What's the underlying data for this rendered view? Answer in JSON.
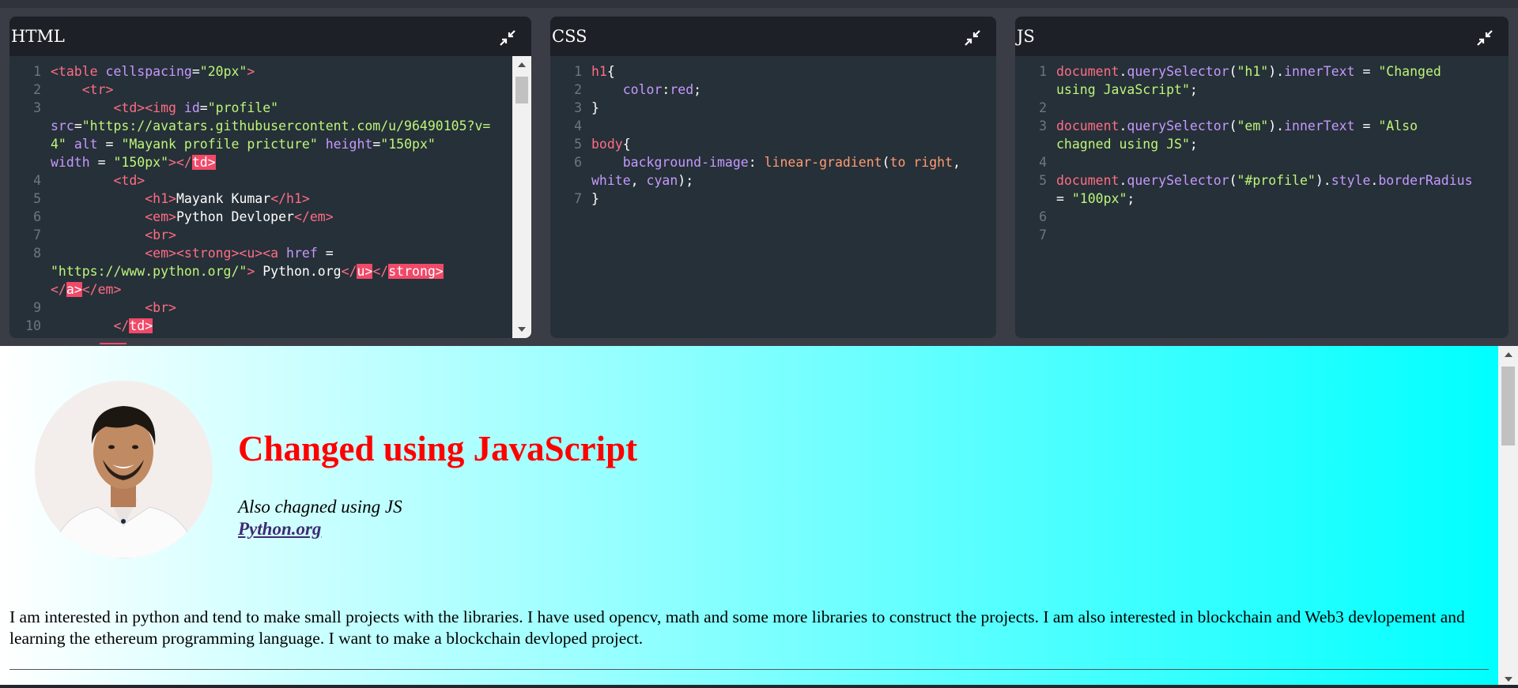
{
  "panels": {
    "html": {
      "title": "HTML",
      "lines": [
        {
          "n": "1",
          "segs": [
            {
              "c": "tg",
              "t": "<table "
            },
            {
              "c": "at",
              "t": "cellspacing"
            },
            {
              "c": "",
              "t": "="
            },
            {
              "c": "st",
              "t": "\"20px\""
            },
            {
              "c": "tg",
              "t": ">"
            }
          ]
        },
        {
          "n": "2",
          "segs": [
            {
              "c": "",
              "t": "    "
            },
            {
              "c": "tg",
              "t": "<tr>"
            }
          ]
        },
        {
          "n": "3",
          "segs": [
            {
              "c": "",
              "t": "        "
            },
            {
              "c": "tg",
              "t": "<td><img "
            },
            {
              "c": "at",
              "t": "id"
            },
            {
              "c": "",
              "t": "="
            },
            {
              "c": "st",
              "t": "\"profile\""
            },
            {
              "c": "",
              "t": "\n"
            },
            {
              "c": "at",
              "t": "src"
            },
            {
              "c": "",
              "t": "="
            },
            {
              "c": "st",
              "t": "\"https://avatars.githubusercontent.com/u/96490105?v=4\""
            },
            {
              "c": "",
              "t": " "
            },
            {
              "c": "at",
              "t": "alt"
            },
            {
              "c": "",
              "t": " = "
            },
            {
              "c": "st",
              "t": "\"Mayank profile pricture\""
            },
            {
              "c": "",
              "t": " "
            },
            {
              "c": "at",
              "t": "height"
            },
            {
              "c": "",
              "t": "="
            },
            {
              "c": "st",
              "t": "\"150px\""
            },
            {
              "c": "",
              "t": "\n"
            },
            {
              "c": "at",
              "t": "width"
            },
            {
              "c": "",
              "t": " = "
            },
            {
              "c": "st",
              "t": "\"150px\""
            },
            {
              "c": "tg",
              "t": "></"
            },
            {
              "c": "hl",
              "t": "td>"
            }
          ]
        },
        {
          "n": "4",
          "segs": [
            {
              "c": "",
              "t": "        "
            },
            {
              "c": "tg",
              "t": "<td>"
            }
          ]
        },
        {
          "n": "5",
          "segs": [
            {
              "c": "",
              "t": "            "
            },
            {
              "c": "tg",
              "t": "<h1>"
            },
            {
              "c": "",
              "t": "Mayank Kumar"
            },
            {
              "c": "tg",
              "t": "</h1>"
            }
          ]
        },
        {
          "n": "6",
          "segs": [
            {
              "c": "",
              "t": "            "
            },
            {
              "c": "tg",
              "t": "<em>"
            },
            {
              "c": "",
              "t": "Python Devloper"
            },
            {
              "c": "tg",
              "t": "</em>"
            }
          ]
        },
        {
          "n": "7",
          "segs": [
            {
              "c": "",
              "t": "            "
            },
            {
              "c": "tg",
              "t": "<br>"
            }
          ]
        },
        {
          "n": "8",
          "segs": [
            {
              "c": "",
              "t": "            "
            },
            {
              "c": "tg",
              "t": "<em><strong><u><a "
            },
            {
              "c": "at",
              "t": "href"
            },
            {
              "c": "",
              "t": " =\n"
            },
            {
              "c": "st",
              "t": "\"https://www.python.org/\""
            },
            {
              "c": "tg",
              "t": ">"
            },
            {
              "c": "",
              "t": " Python.org"
            },
            {
              "c": "tg",
              "t": "</"
            },
            {
              "c": "hl",
              "t": "u>"
            },
            {
              "c": "tg",
              "t": "</"
            },
            {
              "c": "hl",
              "t": "strong>"
            },
            {
              "c": "",
              "t": "\n"
            },
            {
              "c": "tg",
              "t": "</"
            },
            {
              "c": "hl",
              "t": "a>"
            },
            {
              "c": "tg",
              "t": "</em>"
            }
          ]
        },
        {
          "n": "9",
          "segs": [
            {
              "c": "",
              "t": "            "
            },
            {
              "c": "tg",
              "t": "<br>"
            }
          ]
        },
        {
          "n": "10",
          "segs": [
            {
              "c": "",
              "t": "        "
            },
            {
              "c": "tg",
              "t": "</"
            },
            {
              "c": "hl",
              "t": "td>"
            }
          ]
        }
      ]
    },
    "css": {
      "title": "CSS",
      "lines": [
        {
          "n": "1",
          "segs": [
            {
              "c": "tg",
              "t": "h1"
            },
            {
              "c": "",
              "t": "{"
            }
          ]
        },
        {
          "n": "2",
          "segs": [
            {
              "c": "",
              "t": "    "
            },
            {
              "c": "at",
              "t": "color"
            },
            {
              "c": "",
              "t": ":"
            },
            {
              "c": "at",
              "t": "red"
            },
            {
              "c": "",
              "t": ";"
            }
          ]
        },
        {
          "n": "3",
          "segs": [
            {
              "c": "",
              "t": "}"
            }
          ]
        },
        {
          "n": "4",
          "segs": [
            {
              "c": "",
              "t": ""
            }
          ]
        },
        {
          "n": "5",
          "segs": [
            {
              "c": "tg",
              "t": "body"
            },
            {
              "c": "",
              "t": "{"
            }
          ]
        },
        {
          "n": "6",
          "segs": [
            {
              "c": "",
              "t": "    "
            },
            {
              "c": "at",
              "t": "background-image"
            },
            {
              "c": "",
              "t": ": "
            },
            {
              "c": "fn",
              "t": "linear-gradient"
            },
            {
              "c": "",
              "t": "("
            },
            {
              "c": "fn",
              "t": "to right"
            },
            {
              "c": "",
              "t": ",\n"
            },
            {
              "c": "at",
              "t": "white"
            },
            {
              "c": "",
              "t": ", "
            },
            {
              "c": "at",
              "t": "cyan"
            },
            {
              "c": "",
              "t": ");"
            }
          ]
        },
        {
          "n": "7",
          "segs": [
            {
              "c": "",
              "t": "}"
            }
          ]
        }
      ]
    },
    "js": {
      "title": "JS",
      "lines": [
        {
          "n": "1",
          "segs": [
            {
              "c": "tg",
              "t": "document"
            },
            {
              "c": "",
              "t": "."
            },
            {
              "c": "at",
              "t": "querySelector"
            },
            {
              "c": "",
              "t": "("
            },
            {
              "c": "st",
              "t": "\"h1\""
            },
            {
              "c": "",
              "t": ")."
            },
            {
              "c": "at",
              "t": "innerText"
            },
            {
              "c": "",
              "t": " = "
            },
            {
              "c": "st",
              "t": "\"Changed\nusing JavaScript\""
            },
            {
              "c": "",
              "t": ";"
            }
          ]
        },
        {
          "n": "2",
          "segs": [
            {
              "c": "",
              "t": ""
            }
          ]
        },
        {
          "n": "3",
          "segs": [
            {
              "c": "tg",
              "t": "document"
            },
            {
              "c": "",
              "t": "."
            },
            {
              "c": "at",
              "t": "querySelector"
            },
            {
              "c": "",
              "t": "("
            },
            {
              "c": "st",
              "t": "\"em\""
            },
            {
              "c": "",
              "t": ")."
            },
            {
              "c": "at",
              "t": "innerText"
            },
            {
              "c": "",
              "t": " = "
            },
            {
              "c": "st",
              "t": "\"Also\nchagned using JS\""
            },
            {
              "c": "",
              "t": ";"
            }
          ]
        },
        {
          "n": "4",
          "segs": [
            {
              "c": "",
              "t": ""
            }
          ]
        },
        {
          "n": "5",
          "segs": [
            {
              "c": "tg",
              "t": "document"
            },
            {
              "c": "",
              "t": "."
            },
            {
              "c": "at",
              "t": "querySelector"
            },
            {
              "c": "",
              "t": "("
            },
            {
              "c": "st",
              "t": "\"#profile\""
            },
            {
              "c": "",
              "t": ")."
            },
            {
              "c": "at",
              "t": "style"
            },
            {
              "c": "",
              "t": "."
            },
            {
              "c": "at",
              "t": "borderRadius"
            },
            {
              "c": "",
              "t": "\n= "
            },
            {
              "c": "st",
              "t": "\"100px\""
            },
            {
              "c": "",
              "t": ";"
            }
          ]
        },
        {
          "n": "6",
          "segs": [
            {
              "c": "",
              "t": ""
            }
          ]
        },
        {
          "n": "7",
          "segs": [
            {
              "c": "",
              "t": ""
            }
          ]
        }
      ]
    }
  },
  "preview": {
    "heading": "Changed using JavaScript",
    "subtitle": "Also chagned using JS",
    "link": "Python.org",
    "bio": "I am interested in python and tend to make small projects with the libraries. I have used opencv, math and some more libraries to construct the projects. I am also interested in blockchain and Web3 devlopement and learning the ethereum programming language. I want to make a blockchain devloped project."
  },
  "icons": {
    "collapse": "collapse-arrows-icon",
    "scroll_up": "scroll-up-arrow-icon",
    "scroll_down": "scroll-down-arrow-icon",
    "avatar": "profile-photo"
  },
  "colors": {
    "html_tag": "#ff6d85",
    "attribute": "#c599ff",
    "string": "#bdf57a",
    "function": "#ff9b73",
    "highlight": "#f14a69",
    "heading": "#ff0000",
    "link": "#3e2a73",
    "gradient_start": "#ffffff",
    "gradient_end": "#00ffff"
  }
}
